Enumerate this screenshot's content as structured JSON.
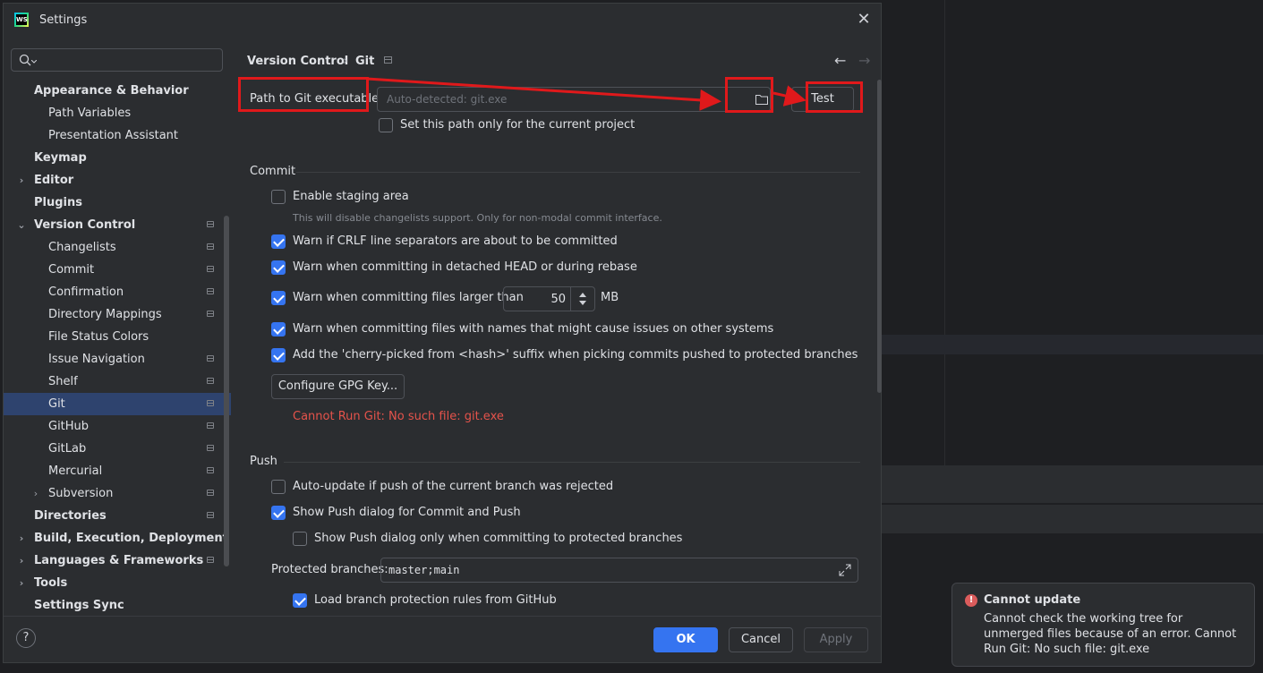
{
  "dialog": {
    "title": "Settings",
    "app_icon": "webstorm-logo",
    "app_icon_text": "WS"
  },
  "search": {
    "placeholder": "",
    "value": ""
  },
  "tree": {
    "items": [
      {
        "label": "Appearance & Behavior",
        "level": 0,
        "bold": true,
        "arrow": "",
        "project": false,
        "selected": false
      },
      {
        "label": "Path Variables",
        "level": 1,
        "bold": false,
        "arrow": "",
        "project": false,
        "selected": false
      },
      {
        "label": "Presentation Assistant",
        "level": 1,
        "bold": false,
        "arrow": "",
        "project": false,
        "selected": false
      },
      {
        "label": "Keymap",
        "level": 0,
        "bold": true,
        "arrow": "",
        "project": false,
        "selected": false
      },
      {
        "label": "Editor",
        "level": 0,
        "bold": true,
        "arrow": "›",
        "project": false,
        "selected": false
      },
      {
        "label": "Plugins",
        "level": 0,
        "bold": true,
        "arrow": "",
        "project": false,
        "selected": false
      },
      {
        "label": "Version Control",
        "level": 0,
        "bold": true,
        "arrow": "⌄",
        "project": true,
        "selected": false
      },
      {
        "label": "Changelists",
        "level": 1,
        "bold": false,
        "arrow": "",
        "project": true,
        "selected": false
      },
      {
        "label": "Commit",
        "level": 1,
        "bold": false,
        "arrow": "",
        "project": true,
        "selected": false
      },
      {
        "label": "Confirmation",
        "level": 1,
        "bold": false,
        "arrow": "",
        "project": true,
        "selected": false
      },
      {
        "label": "Directory Mappings",
        "level": 1,
        "bold": false,
        "arrow": "",
        "project": true,
        "selected": false
      },
      {
        "label": "File Status Colors",
        "level": 1,
        "bold": false,
        "arrow": "",
        "project": false,
        "selected": false
      },
      {
        "label": "Issue Navigation",
        "level": 1,
        "bold": false,
        "arrow": "",
        "project": true,
        "selected": false
      },
      {
        "label": "Shelf",
        "level": 1,
        "bold": false,
        "arrow": "",
        "project": true,
        "selected": false
      },
      {
        "label": "Git",
        "level": 1,
        "bold": false,
        "arrow": "",
        "project": true,
        "selected": true
      },
      {
        "label": "GitHub",
        "level": 1,
        "bold": false,
        "arrow": "",
        "project": true,
        "selected": false
      },
      {
        "label": "GitLab",
        "level": 1,
        "bold": false,
        "arrow": "",
        "project": true,
        "selected": false
      },
      {
        "label": "Mercurial",
        "level": 1,
        "bold": false,
        "arrow": "",
        "project": true,
        "selected": false
      },
      {
        "label": "Subversion",
        "level": 1,
        "bold": false,
        "arrow": "›",
        "project": true,
        "selected": false
      },
      {
        "label": "Directories",
        "level": 0,
        "bold": true,
        "arrow": "",
        "project": true,
        "selected": false
      },
      {
        "label": "Build, Execution, Deployment",
        "level": 0,
        "bold": true,
        "arrow": "›",
        "project": false,
        "selected": false
      },
      {
        "label": "Languages & Frameworks",
        "level": 0,
        "bold": true,
        "arrow": "›",
        "project": true,
        "selected": false
      },
      {
        "label": "Tools",
        "level": 0,
        "bold": true,
        "arrow": "›",
        "project": false,
        "selected": false
      },
      {
        "label": "Settings Sync",
        "level": 0,
        "bold": true,
        "arrow": "",
        "project": false,
        "selected": false
      }
    ]
  },
  "breadcrumb": {
    "parent": "Version Control",
    "separator": "›",
    "current": "Git"
  },
  "git_path": {
    "label": "Path to Git executable:",
    "placeholder": "Auto-detected: git.exe",
    "test_button": "Test",
    "only_current_project": {
      "label": "Set this path only for the current project",
      "checked": false
    }
  },
  "commit": {
    "title": "Commit",
    "enable_staging": {
      "label": "Enable staging area",
      "checked": false
    },
    "staging_hint": "This will disable changelists support. Only for non-modal commit interface.",
    "warn_crlf": {
      "label": "Warn if CRLF line separators are about to be committed",
      "checked": true
    },
    "warn_detached": {
      "label": "Warn when committing in detached HEAD or during rebase",
      "checked": true
    },
    "warn_large": {
      "label": "Warn when committing files larger than",
      "checked": true,
      "value": "50",
      "unit": "MB"
    },
    "warn_names": {
      "label": "Warn when committing files with names that might cause issues on other systems",
      "checked": true
    },
    "cherry_pick": {
      "label": "Add the 'cherry-picked from <hash>' suffix when picking commits pushed to protected branches",
      "checked": true
    },
    "gpg_button": "Configure GPG Key...",
    "error": "Cannot Run Git: No such file: git.exe"
  },
  "push": {
    "title": "Push",
    "auto_update": {
      "label": "Auto-update if push of the current branch was rejected",
      "checked": false
    },
    "show_dialog": {
      "label": "Show Push dialog for Commit and Push",
      "checked": true
    },
    "show_dialog_protected": {
      "label": "Show Push dialog only when committing to protected branches",
      "checked": false
    },
    "protected_label": "Protected branches:",
    "protected_value": "master;main",
    "load_rules": {
      "label": "Load branch protection rules from GitHub",
      "checked": true
    }
  },
  "buttons": {
    "ok": "OK",
    "cancel": "Cancel",
    "apply": "Apply",
    "help": "?"
  },
  "toast": {
    "title": "Cannot update",
    "body": "Cannot check the working tree for unmerged files because of an error. Cannot Run Git: No such file: git.exe",
    "icon": "error-icon"
  },
  "colors": {
    "accent": "#3574f0",
    "error": "#e5534b",
    "annotation": "#e0191b",
    "selected": "#2e436e"
  }
}
